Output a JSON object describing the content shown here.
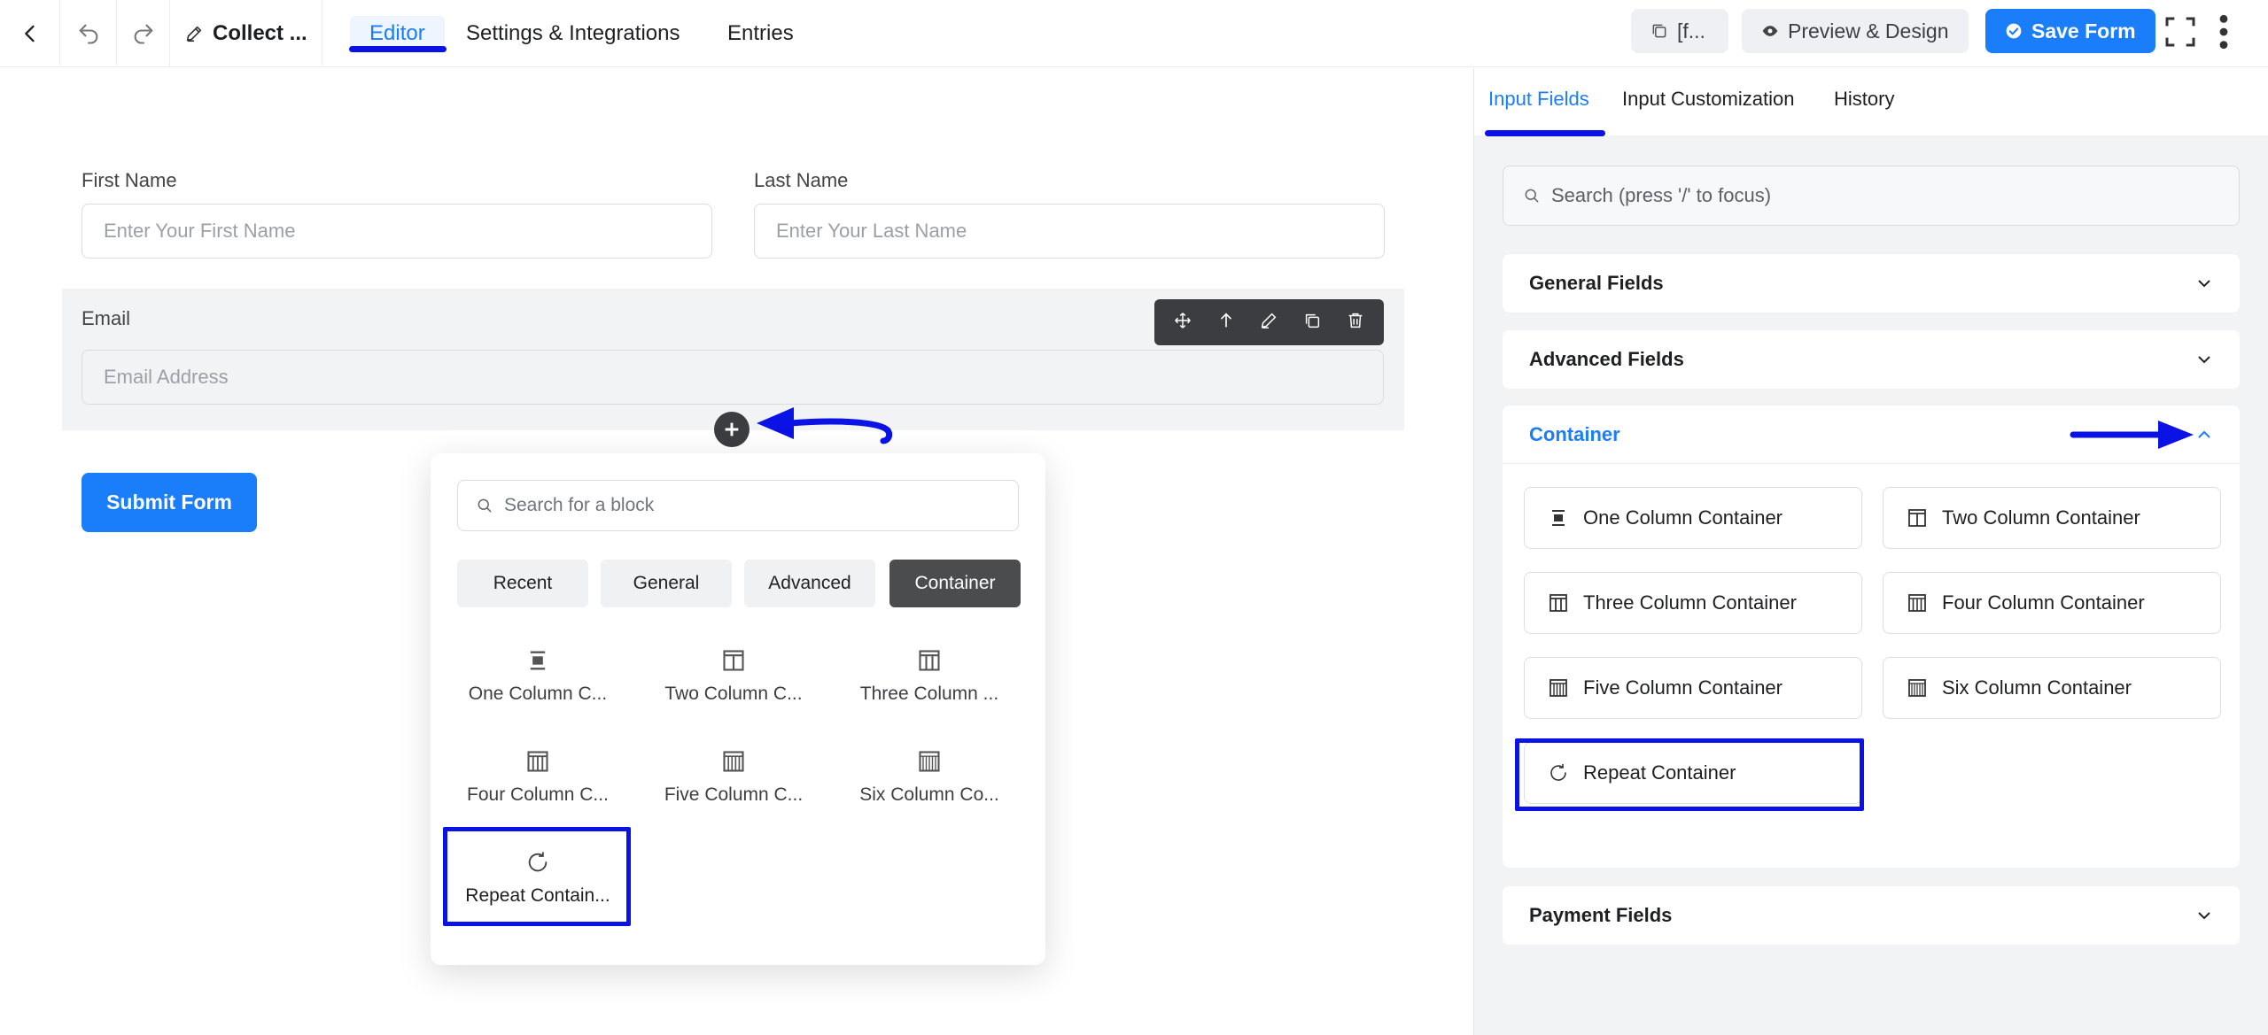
{
  "header": {
    "form_title": "Collect ...",
    "tabs": [
      {
        "label": "Editor",
        "active": true
      },
      {
        "label": "Settings & Integrations",
        "active": false
      },
      {
        "label": "Entries",
        "active": false
      }
    ],
    "shortcode_label": "[f...",
    "preview_label": "Preview & Design",
    "save_label": "Save Form",
    "accent_color": "#1a7efb"
  },
  "form": {
    "first_name": {
      "label": "First Name",
      "placeholder": "Enter Your First Name"
    },
    "last_name": {
      "label": "Last Name",
      "placeholder": "Enter Your Last Name"
    },
    "email": {
      "label": "Email",
      "placeholder": "Email Address"
    },
    "submit_label": "Submit Form"
  },
  "block_picker": {
    "search_placeholder": "Search for a block",
    "tabs": [
      {
        "label": "Recent",
        "active": false
      },
      {
        "label": "General",
        "active": false
      },
      {
        "label": "Advanced",
        "active": false
      },
      {
        "label": "Container",
        "active": true
      }
    ],
    "blocks": [
      {
        "label": "One Column C...",
        "icon": "one-column-icon"
      },
      {
        "label": "Two Column C...",
        "icon": "two-column-icon"
      },
      {
        "label": "Three Column ...",
        "icon": "three-column-icon"
      },
      {
        "label": "Four Column C...",
        "icon": "four-column-icon"
      },
      {
        "label": "Five Column C...",
        "icon": "five-column-icon"
      },
      {
        "label": "Six Column Co...",
        "icon": "six-column-icon"
      },
      {
        "label": "Repeat Contain...",
        "icon": "repeat-icon"
      }
    ]
  },
  "sidebar": {
    "tabs": [
      {
        "label": "Input Fields",
        "active": true
      },
      {
        "label": "Input Customization",
        "active": false
      },
      {
        "label": "History",
        "active": false
      }
    ],
    "search_placeholder": "Search (press '/' to focus)",
    "sections": {
      "general": "General Fields",
      "advanced": "Advanced Fields",
      "container": "Container",
      "payment": "Payment Fields"
    },
    "container_items": [
      {
        "label": "One Column Container",
        "icon": "one-column-icon"
      },
      {
        "label": "Two Column Container",
        "icon": "two-column-icon"
      },
      {
        "label": "Three Column Container",
        "icon": "three-column-icon"
      },
      {
        "label": "Four Column Container",
        "icon": "four-column-icon"
      },
      {
        "label": "Five Column Container",
        "icon": "five-column-icon"
      },
      {
        "label": "Six Column Container",
        "icon": "six-column-icon"
      },
      {
        "label": "Repeat Container",
        "icon": "repeat-icon"
      }
    ]
  },
  "annotation_color": "#0b12e6"
}
